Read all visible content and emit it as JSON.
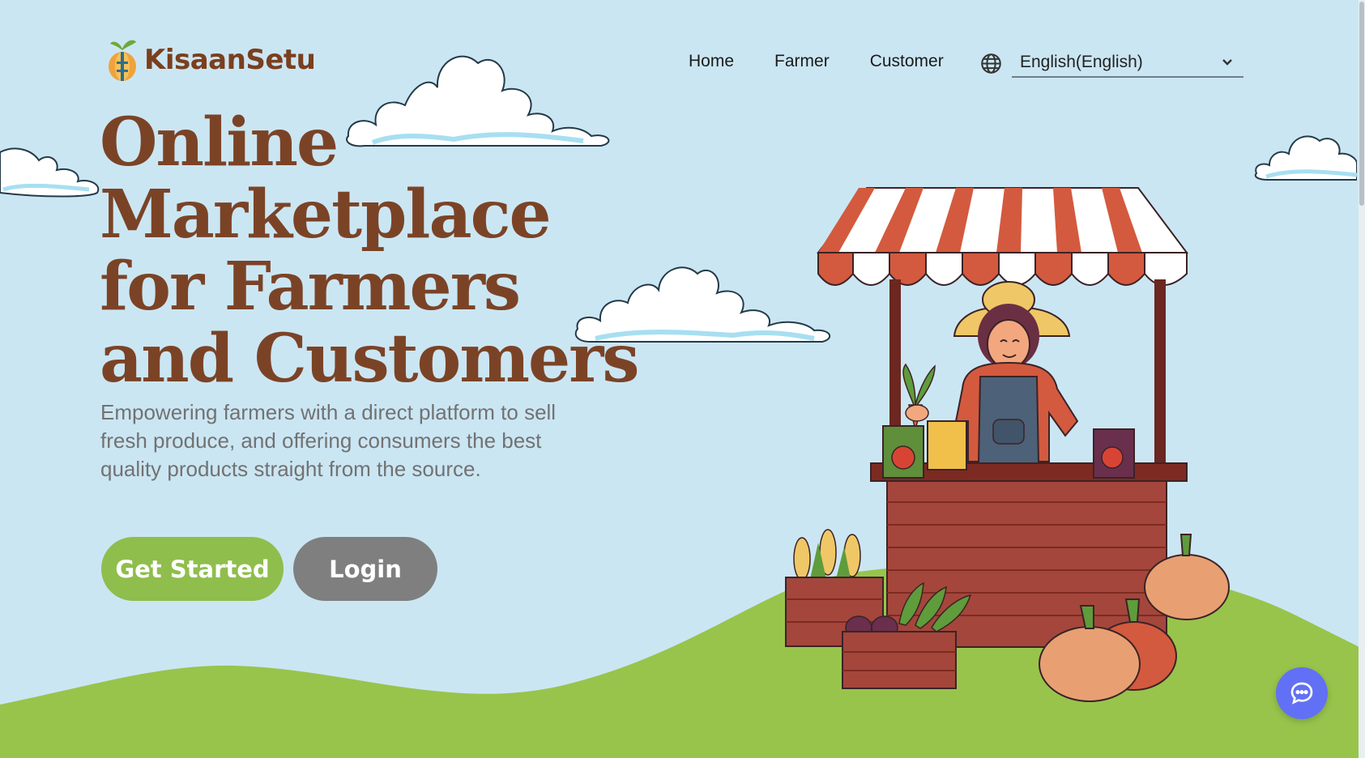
{
  "brand": {
    "name": "KisaanSetu"
  },
  "nav": {
    "items": [
      "Home",
      "Farmer",
      "Customer"
    ]
  },
  "language": {
    "selected": "English(English)"
  },
  "hero": {
    "title_lines": [
      "Online",
      "Marketplace",
      "for Farmers",
      "and Customers"
    ],
    "subtitle": "Empowering farmers with a direct platform to sell fresh produce, and offering consumers the best quality products straight from the source."
  },
  "buttons": {
    "get_started": "Get Started",
    "login": "Login"
  },
  "colors": {
    "sky": "#cbe6f3",
    "hill": "#98c44c",
    "title": "#7b4326",
    "get_started": "#8fbe4d",
    "login": "#7f7f7f",
    "chat": "#6270f5"
  },
  "icons": {
    "language": "globe-icon",
    "dropdown": "chevron-down-icon",
    "chat": "chat-bubble-icon"
  }
}
